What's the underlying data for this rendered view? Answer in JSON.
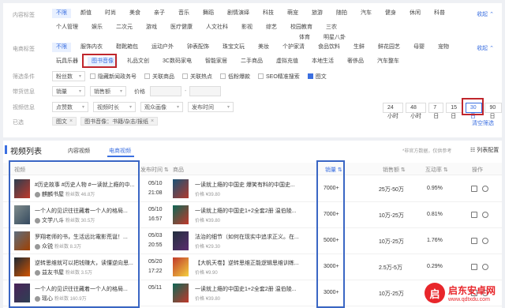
{
  "filters": {
    "content_tag_label": "内容标签",
    "content_tags_row1": [
      "不限",
      "颜值",
      "时尚",
      "美食",
      "亲子",
      "音乐",
      "舞蹈",
      "剧情演绎",
      "科技",
      "萌宠",
      "旅游",
      "随拍",
      "汽车",
      "健身",
      "休闲",
      "科普"
    ],
    "content_tags_row2": [
      "个人管理",
      "娱乐",
      "二次元",
      "游戏",
      "医疗健康",
      "人文社科",
      "影视",
      "综艺",
      "校园教育",
      "三农"
    ],
    "content_tags_row3": [
      "体育",
      "明星八卦"
    ],
    "collapse_label": "收起",
    "ecom_label": "电商标签",
    "ecom_tags_row1": [
      "不限",
      "服饰内衣",
      "鞋靴箱包",
      "运动户外",
      "钟表配饰",
      "珠宝文玩",
      "美妆",
      "个护家清",
      "食品饮料",
      "生鲜",
      "鲜花园艺",
      "母婴",
      "宠物"
    ],
    "ecom_tags_row2": [
      "玩具乐器",
      "图书音像",
      "礼品文创",
      "3C数码家电",
      "智能家居",
      "二手商品",
      "虚拟充值",
      "本地生活",
      "奢侈品",
      "汽车整车"
    ],
    "filter_cond_label": "筛选条件",
    "filter_cond": [
      {
        "label": "粉丝数",
        "type": "select"
      },
      {
        "label": "隐藏新闻政务号",
        "checked": false
      },
      {
        "label": "关联商品",
        "checked": false
      },
      {
        "label": "关联热点",
        "checked": false
      },
      {
        "label": "低粉爆款",
        "checked": false
      },
      {
        "label": "SEO精准搜索",
        "checked": false
      },
      {
        "label": "图文",
        "checked": true
      }
    ],
    "goods_label": "带货信息",
    "goods_selects": [
      "销量",
      "销售额"
    ],
    "price_label": "价格",
    "video_info_label": "视频信息",
    "video_selects": [
      "点赞数",
      "视频时长",
      "观众画像",
      "发布时间"
    ],
    "day_buttons": [
      "24小时",
      "48小时",
      "7日",
      "15日",
      "30日",
      "90日"
    ],
    "active_day": "30日",
    "selected_label": "已选",
    "selected_tags": [
      "图文",
      "图书音像：书籍/杂志/报纸"
    ],
    "clear_label": "清空筛选"
  },
  "list": {
    "title": "视频列表",
    "tabs": [
      "内容视频",
      "电商视频"
    ],
    "active_tab": "电商视频",
    "note": "*非官方数据，仅供参考",
    "settings_label": "列表配置",
    "columns": [
      "视频",
      "发布时间",
      "商品",
      "销量",
      "销售额",
      "互动率",
      "操作"
    ],
    "rows": [
      {
        "title": "#历史故事 #历史人物 #一读就上瘾的中...",
        "author": "麒麟书屋",
        "fans": "粉丝数 46.8万",
        "date": "05/10",
        "time": "21:08",
        "product": "一读就上瘾的中国史 爆笑有料的中国史...",
        "price": "价格 ¥39.80",
        "sales": "7000+",
        "revenue": "25万-50万",
        "rate": "0.95%"
      },
      {
        "title": "一个人的见识往往藏着一个人的格局...",
        "author": "文学八斗",
        "fans": "粉丝数 30.5万",
        "date": "05/10",
        "time": "16:57",
        "product": "一读就上瘾的中国史1+2全套2册 温伯陵...",
        "price": "价格 ¥39.80",
        "sales": "7000+",
        "revenue": "10万-25万",
        "rate": "0.81%"
      },
      {
        "title": "罗翔老师的书，生活远比電影荒诞！...",
        "author": "众锐",
        "fans": "粉丝数 8.3万",
        "date": "05/03",
        "time": "20:55",
        "product": "法治的细节（如何在现实中追求正义。在...",
        "price": "价格 ¥29.30",
        "sales": "5000+",
        "revenue": "10万-25万",
        "rate": "1.76%"
      },
      {
        "title": "逆转思维就可以把钱赚大，读懂逆向思...",
        "author": "益友书屋",
        "fans": "粉丝数 3.5万",
        "date": "05/20",
        "time": "17:22",
        "product": "【大帆天卷】逆转思维正能逻辑思维训练...",
        "price": "价格 ¥9.90",
        "sales": "3000+",
        "revenue": "2.5万-5万",
        "rate": "0.29%"
      },
      {
        "title": "一个人的见识往往藏着一个人的格局...",
        "author": "瑶心",
        "fans": "粉丝数 160.9万",
        "date": "05/11",
        "time": "",
        "product": "一读就上瘾的中国史1+2全套2册 温伯陵...",
        "price": "价格 ¥39.80",
        "sales": "3000+",
        "revenue": "10万-25万",
        "rate": ""
      }
    ]
  },
  "watermark": {
    "logo": "启",
    "line1": "启东安卓网",
    "line2": "www.qdtxdu.com"
  },
  "colors": {
    "accent": "#3b6fe0",
    "red_box": "#c0262c",
    "blue_box": "#3a66c4",
    "watermark": "#e8262b"
  }
}
